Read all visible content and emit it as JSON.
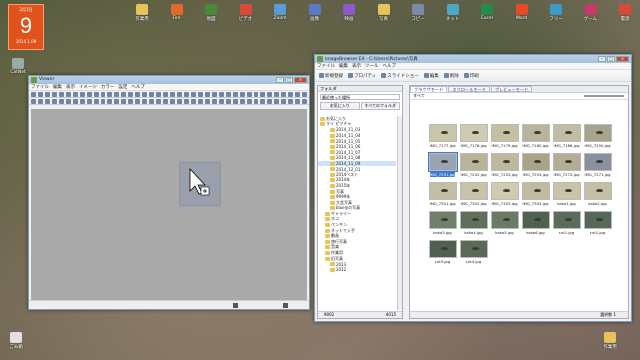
{
  "calendar": {
    "month": "2月1日",
    "day": "9",
    "footer": "2014 1.09"
  },
  "desktop": {
    "left_icons": [
      {
        "label": "ごみ箱",
        "color": "#d9d9d9"
      },
      {
        "label": "CatNet"
      }
    ],
    "top_icons": [
      {
        "label": "作業用",
        "color": "#e8c35a"
      },
      {
        "label": "Fire",
        "color": "#e06a2a"
      },
      {
        "label": "地図",
        "color": "#4a8a3a"
      },
      {
        "label": "ビデオ",
        "color": "#d84a3a"
      },
      {
        "label": "Zoom",
        "color": "#5a9ad8"
      },
      {
        "label": "画像",
        "color": "#5a7ac8"
      },
      {
        "label": "映画",
        "color": "#8a5ac8"
      },
      {
        "label": "写真",
        "color": "#e8c35a"
      },
      {
        "label": "コピー",
        "color": "#7a8aa8"
      },
      {
        "label": "ネット",
        "color": "#4aa8c8"
      },
      {
        "label": "Excel",
        "color": "#2a8a4a"
      },
      {
        "label": "Word",
        "color": "#e84a2a"
      },
      {
        "label": "フリー",
        "color": "#3a9ac8"
      },
      {
        "label": "ゲーム",
        "color": "#c83a6a"
      },
      {
        "label": "電源",
        "color": "#d84a3a"
      }
    ],
    "bottom_icons": [
      {
        "label": "ごみ箱",
        "color": "#e0e0e0"
      },
      {
        "label": "作業用",
        "color": "#e8c35a"
      }
    ]
  },
  "viewer": {
    "title": "Viewer",
    "menu": [
      "ファイル",
      "編集",
      "表示",
      "イメージ",
      "カラー",
      "設定",
      "ヘルプ"
    ],
    "toolbar_count": 40,
    "canvas_color": "#a9a9a9"
  },
  "browser": {
    "title": "ImageBrowser EX - C:\\Users\\Pictures\\写真",
    "menu": [
      "ファイル",
      "編集",
      "表示",
      "ツール",
      "ヘルプ"
    ],
    "toolbar_items": [
      "新規登録",
      "プロパティ",
      "スライドショー",
      "編集",
      "削除",
      "印刷"
    ],
    "left_pane": {
      "header": "フォルダ",
      "field": "最近使った場所",
      "tabs": [
        "お気に入り",
        "すべてのフォルダ"
      ],
      "tree": [
        {
          "label": "お気に入り",
          "indent": 0
        },
        {
          "label": "マイ ピクチャ",
          "indent": 0
        },
        {
          "label": "2014_11_03",
          "indent": 2
        },
        {
          "label": "2014_11_04",
          "indent": 2
        },
        {
          "label": "2014_11_05",
          "indent": 2
        },
        {
          "label": "2014_11_06",
          "indent": 2
        },
        {
          "label": "2014_11_07",
          "indent": 2
        },
        {
          "label": "2014_11_08",
          "indent": 2
        },
        {
          "label": "2014_11_09",
          "indent": 2,
          "selected": true
        },
        {
          "label": "2014_12_01",
          "indent": 2
        },
        {
          "label": "2014ベスト",
          "indent": 2
        },
        {
          "label": "2014年",
          "indent": 2
        },
        {
          "label": "2015年",
          "indent": 2
        },
        {
          "label": "写真",
          "indent": 2
        },
        {
          "label": "9999年",
          "indent": 2
        },
        {
          "label": "大会写真",
          "indent": 2
        },
        {
          "label": "bluelyの写真",
          "indent": 2
        },
        {
          "label": "ギャラリー",
          "indent": 1
        },
        {
          "label": "ネコ",
          "indent": 1
        },
        {
          "label": "ペンギン",
          "indent": 1
        },
        {
          "label": "ネットで入手",
          "indent": 1
        },
        {
          "label": "動画",
          "indent": 1
        },
        {
          "label": "旅行写真",
          "indent": 1
        },
        {
          "label": "音楽",
          "indent": 1
        },
        {
          "label": "作業用",
          "indent": 1
        },
        {
          "label": "旧写真",
          "indent": 1
        },
        {
          "label": "2013",
          "indent": 2
        },
        {
          "label": "2012",
          "indent": 2
        }
      ],
      "status_left": "9002",
      "status_right": "4015"
    },
    "tabs": [
      "ブラウザモード",
      "スクロールモード",
      "プレビューモード"
    ],
    "sort_label": "すべて",
    "thumbnails": [
      {
        "name": "IMG_7177.jpg",
        "bg": "#c9c5a9"
      },
      {
        "name": "IMG_7178.jpg",
        "bg": "#cfcab0"
      },
      {
        "name": "IMG_7179.jpg",
        "bg": "#c5c0a2"
      },
      {
        "name": "IMG_7180.jpg",
        "bg": "#b8b39a"
      },
      {
        "name": "IMG_7186.jpg",
        "bg": "#c2bda2"
      },
      {
        "name": "IMG_7250.jpg",
        "bg": "#a7a38c"
      },
      {
        "name": "IMG_7251.jpg",
        "bg": "#9aa4b0",
        "selected": true
      },
      {
        "name": "IMG_7252.jpg",
        "bg": "#b8b49a"
      },
      {
        "name": "IMG_7253.jpg",
        "bg": "#bdb9a0"
      },
      {
        "name": "IMG_7254.jpg",
        "bg": "#a8a48a"
      },
      {
        "name": "IMG_7270.jpg",
        "bg": "#b2ae96"
      },
      {
        "name": "IMG_7271.jpg",
        "bg": "#8a90a0"
      },
      {
        "name": "IMG_7301.jpg",
        "bg": "#c4bea2"
      },
      {
        "name": "IMG_7302.jpg",
        "bg": "#c8c2a6"
      },
      {
        "name": "IMG_7303.jpg",
        "bg": "#d0cab0"
      },
      {
        "name": "IMG_7304.jpg",
        "bg": "#c0baa0"
      },
      {
        "name": "kaka1.jpg",
        "bg": "#c8c4aa"
      },
      {
        "name": "kaka2.jpg",
        "bg": "#c4bfa5"
      },
      {
        "name": "kaka3.jpg",
        "bg": "#6f7f6a"
      },
      {
        "name": "kaka4.jpg",
        "bg": "#5f6f5a"
      },
      {
        "name": "kaka5.jpg",
        "bg": "#6a7a64"
      },
      {
        "name": "kaka6.jpg",
        "bg": "#4f6250"
      },
      {
        "name": "cut1.jpg",
        "bg": "#5a6b5a"
      },
      {
        "name": "cut2.jpg",
        "bg": "#55685a"
      },
      {
        "name": "cut3.jpg",
        "bg": "#4f5f50"
      },
      {
        "name": "cut4.jpg",
        "bg": "#5a6a58"
      }
    ],
    "status": "選択数 1"
  }
}
